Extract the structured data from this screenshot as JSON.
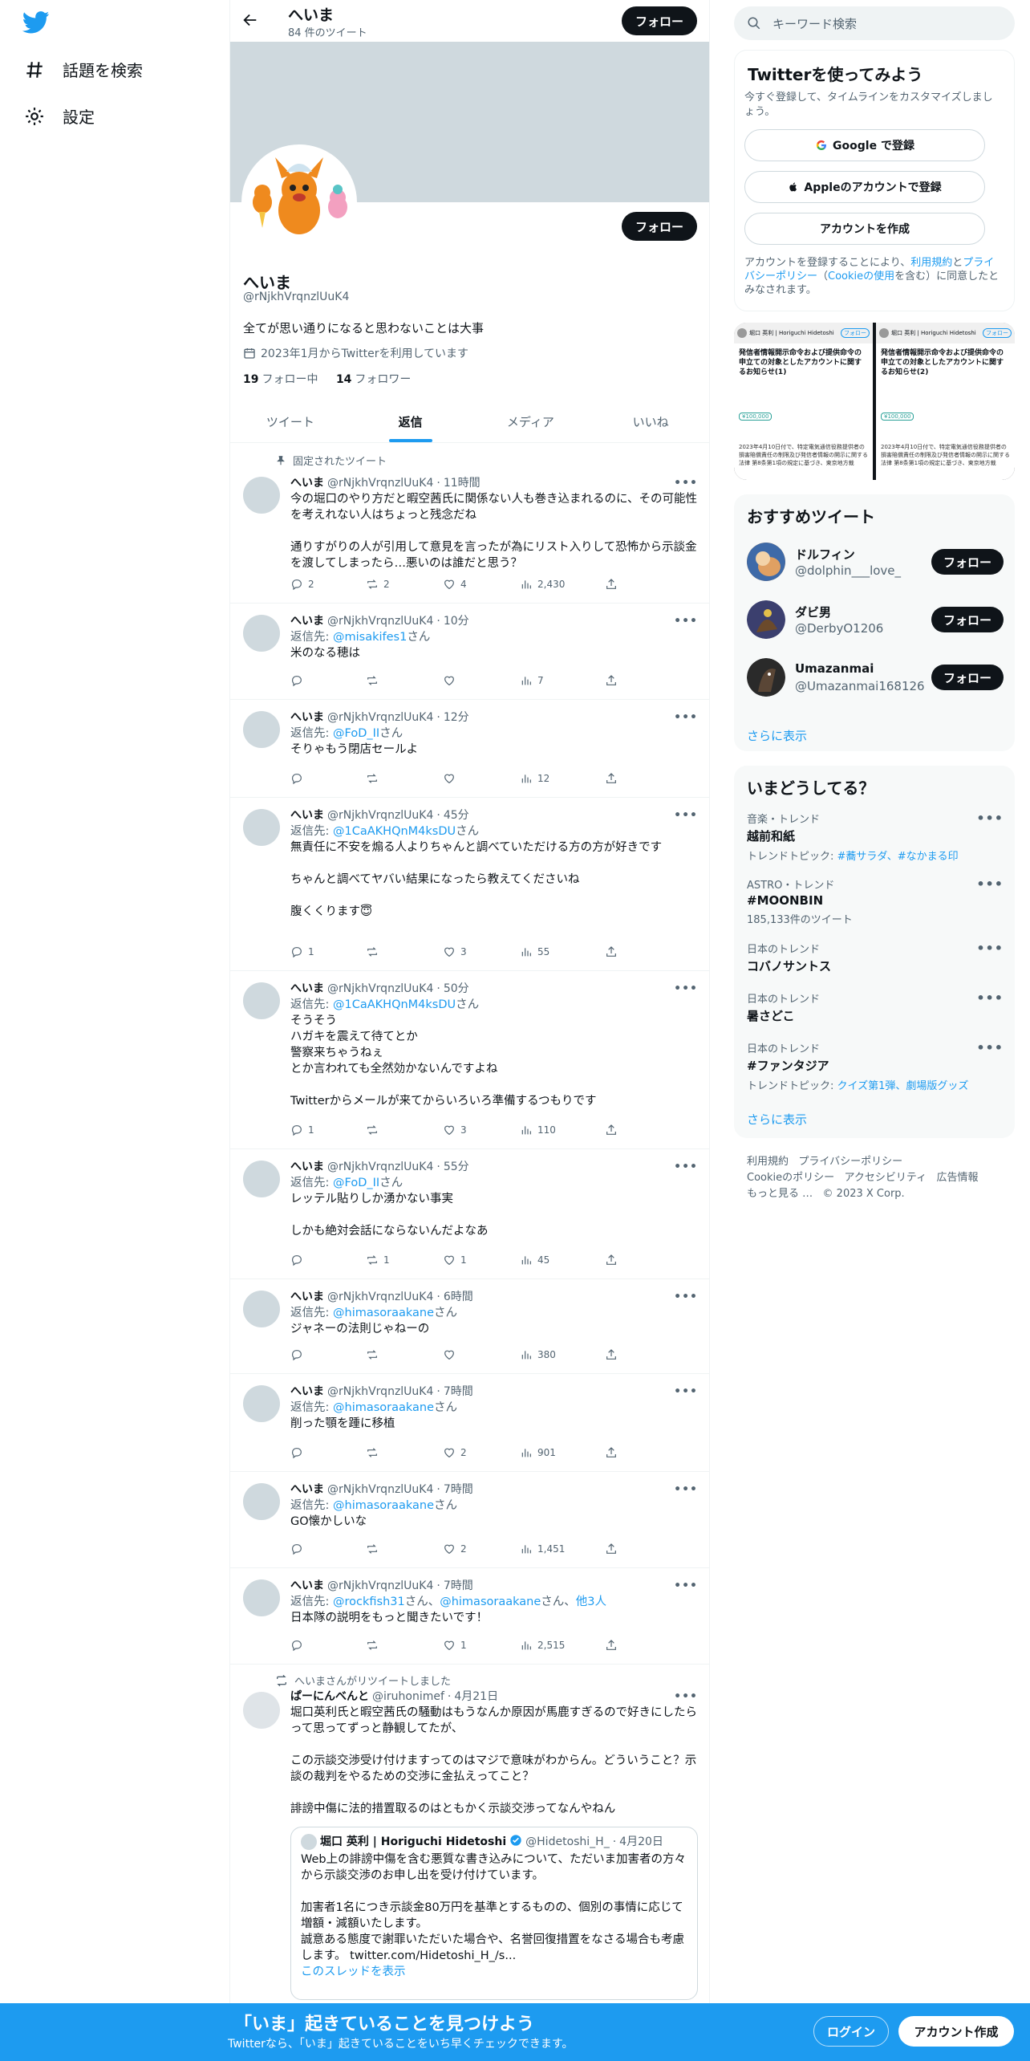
{
  "nav": {
    "explore": "話題を検索",
    "settings": "設定"
  },
  "header": {
    "name": "へいま",
    "tweet_count": "84 件のツイート",
    "follow": "フォロー"
  },
  "profile": {
    "name": "へいま",
    "handle": "@rNjkhVrqnzlUuK4",
    "bio": "全てが思い通りになると思わないことは大事",
    "joined": "2023年1月からTwitterを利用しています",
    "following_count": "19",
    "following_label": "フォロー中",
    "followers_count": "14",
    "followers_label": "フォロワー",
    "follow": "フォロー"
  },
  "tabs": [
    "ツイート",
    "返信",
    "メディア",
    "いいね"
  ],
  "tweets": [
    {
      "pinned": "固定されたツイート",
      "name": "へいま",
      "handle": "@rNjkhVrqnzlUuK4",
      "time": "11時間",
      "reply_to": "",
      "reply_suffix": "",
      "text": "今の堀口のやり方だと暇空茜氏に関係ない人も巻き込まれるのに、その可能性を考えれない人はちょっと残念だね\n\n通りすがりの人が引用して意見を言ったが為にリスト入りして恐怖から示談金を渡してしまったら…悪いのは誰だと思う？",
      "replies": "2",
      "retweets": "2",
      "likes": "4",
      "views": "2,430"
    },
    {
      "name": "へいま",
      "handle": "@rNjkhVrqnzlUuK4",
      "time": "10分",
      "reply_label": "返信先: ",
      "reply_to": "@misakifes1",
      "reply_suffix": "さん",
      "text": "米のなる穂は",
      "replies": "",
      "retweets": "",
      "likes": "",
      "views": "7"
    },
    {
      "name": "へいま",
      "handle": "@rNjkhVrqnzlUuK4",
      "time": "12分",
      "reply_label": "返信先: ",
      "reply_to": "@FoD_II",
      "reply_suffix": "さん",
      "text": "そりゃもう閉店セールよ",
      "replies": "",
      "retweets": "",
      "likes": "",
      "views": "12"
    },
    {
      "name": "へいま",
      "handle": "@rNjkhVrqnzlUuK4",
      "time": "45分",
      "reply_label": "返信先: ",
      "reply_to": "@1CaAKHQnM4ksDU",
      "reply_suffix": "さん",
      "text": "無責任に不安を煽る人よりちゃんと調べていただける方の方が好きです\n\nちゃんと調べてヤバい結果になったら教えてくださいね\n\n腹くくります😇",
      "replies": "1",
      "retweets": "",
      "likes": "3",
      "views": "55"
    },
    {
      "name": "へいま",
      "handle": "@rNjkhVrqnzlUuK4",
      "time": "50分",
      "reply_label": "返信先: ",
      "reply_to": "@1CaAKHQnM4ksDU",
      "reply_suffix": "さん",
      "text": "そうそう\nハガキを震えて待てとか\n警察来ちゃうねぇ\nとか言われても全然効かないんですよね\n\nTwitterからメールが来てからいろいろ準備するつもりです",
      "replies": "1",
      "retweets": "",
      "likes": "3",
      "views": "110"
    },
    {
      "name": "へいま",
      "handle": "@rNjkhVrqnzlUuK4",
      "time": "55分",
      "reply_label": "返信先: ",
      "reply_to": "@FoD_II",
      "reply_suffix": "さん",
      "text": "レッテル貼りしか湧かない事実\n\nしかも絶対会話にならないんだよなあ",
      "replies": "",
      "retweets": "1",
      "likes": "1",
      "views": "45"
    },
    {
      "name": "へいま",
      "handle": "@rNjkhVrqnzlUuK4",
      "time": "6時間",
      "reply_label": "返信先: ",
      "reply_to": "@himasoraakane",
      "reply_suffix": "さん",
      "text": "ジャネーの法則じゃねーの",
      "replies": "",
      "retweets": "",
      "likes": "",
      "views": "380"
    },
    {
      "name": "へいま",
      "handle": "@rNjkhVrqnzlUuK4",
      "time": "7時間",
      "reply_label": "返信先: ",
      "reply_to": "@himasoraakane",
      "reply_suffix": "さん",
      "text": "削った顎を踵に移植",
      "replies": "",
      "retweets": "",
      "likes": "2",
      "views": "901"
    },
    {
      "name": "へいま",
      "handle": "@rNjkhVrqnzlUuK4",
      "time": "7時間",
      "reply_label": "返信先: ",
      "reply_to": "@himasoraakane",
      "reply_suffix": "さん",
      "text": "GO懐かしいな",
      "replies": "",
      "retweets": "",
      "likes": "2",
      "views": "1,451"
    },
    {
      "name": "へいま",
      "handle": "@rNjkhVrqnzlUuK4",
      "time": "7時間",
      "reply_label": "返信先: ",
      "reply_to": "@rockfish31",
      "reply_suffix": "さん、",
      "reply_to2": "@himasoraakane",
      "reply_suffix2": "さん、",
      "reply_to3": "他3人",
      "text": "日本隊の説明をもっと聞きたいです！",
      "replies": "",
      "retweets": "",
      "likes": "1",
      "views": "2,515"
    }
  ],
  "retweet": {
    "context": "へいまさんがリツイートしました",
    "name": "ぱーにんべんと",
    "handle": "@iruhonimef",
    "time": "4月21日",
    "text": "堀口英利氏と暇空茜氏の騒動はもうなんか原因が馬鹿すぎるので好きにしたらって思ってずっと静観してたが、\n\nこの示談交渉受け付けますってのはマジで意味がわからん。どういうこと？示談の裁判をやるための交渉に金払えってこと？\n\n誹謗中傷に法的措置取るのはともかく示談交渉ってなんやねん",
    "quote": {
      "name": "堀口 英利 | Horiguchi Hidetoshi",
      "handle": "@Hidetoshi_H_",
      "time": "4月20日",
      "text": "Web上の誹謗中傷を含む悪質な書き込みについて、ただいま加害者の方々から示談交渉のお申し出を受け付けています。\n\n加害者1名につき示談金80万円を基準とするものの、個別の事情に応じて増額・減額いたします。\n誠意ある態度で謝罪いただいた場合や、名誉回復措置をなさる場合も考慮します。 twitter.com/Hidetoshi_H_/s...",
      "thread": "このスレッドを表示"
    }
  },
  "right": {
    "search_placeholder": "キーワード検索",
    "signup": {
      "title": "Twitterを使ってみよう",
      "subtitle": "今すぐ登録して、タイムラインをカスタマイズしましょう。",
      "google": "Google で登録",
      "apple": "Appleのアカウントで登録",
      "create": "アカウントを作成",
      "legal_1": "アカウントを登録することにより、",
      "legal_terms": "利用規約",
      "legal_2": "と",
      "legal_privacy": "プライバシーポリシー",
      "legal_3": "（",
      "legal_cookie": "Cookieの使用",
      "legal_4": "を含む）に同意したとみなされます。"
    },
    "media": {
      "left_title": "発信者情報開示命令および提供命令の申立ての対象としたアカウントに関するお知らせ(1)",
      "right_title": "発信者情報開示命令および提供命令の申立ての対象としたアカウントに関するお知らせ(2)",
      "left_amount": "¥100,000",
      "right_amount": "¥100,000",
      "left_author": "堀口 英利 | Horiguchi Hidetoshi",
      "right_author": "堀口 英利 | Horiguchi Hidetoshi",
      "left_follow": "フォロー",
      "right_follow": "フォロー",
      "left_excerpt": "2023年4月10日付で、特定電気通信役務提供者の損害賠償責任の制限及び発信者情報の開示に関する法律 第8条第1項の規定に基づき、東京地方裁",
      "right_excerpt": "2023年4月10日付で、特定電気通信役務提供者の損害賠償責任の制限及び発信者情報の開示に関する法律 第8条第1項の規定に基づき、東京地方裁"
    },
    "recommend": {
      "title": "おすすめツイート",
      "users": [
        {
          "name": "ドルフィン",
          "handle": "@dolphin___love_",
          "follow": "フォロー"
        },
        {
          "name": "ダビ男",
          "handle": "@DerbyO1206",
          "follow": "フォロー"
        },
        {
          "name": "Umazanmai",
          "handle": "@Umazanmai168126",
          "follow": "フォロー"
        }
      ],
      "more": "さらに表示"
    },
    "trends": {
      "title": "いまどうしてる？",
      "items": [
        {
          "cat": "音楽・トレンド",
          "title": "越前和紙",
          "sub_label": "トレンドトピック: ",
          "sub_link": "#蕎サラダ、#なかまる印"
        },
        {
          "cat": "ASTRO・トレンド",
          "title": "#MOONBIN",
          "sub_label": "185,133件のツイート",
          "sub_link": ""
        },
        {
          "cat": "日本のトレンド",
          "title": "コバノサントス",
          "sub_label": "",
          "sub_link": ""
        },
        {
          "cat": "日本のトレンド",
          "title": "暑さどこ",
          "sub_label": "",
          "sub_link": ""
        },
        {
          "cat": "日本のトレンド",
          "title": "#ファンタジア",
          "sub_label": "トレンドトピック: ",
          "sub_link": "クイズ第1弾、劇場版グッズ"
        }
      ],
      "more": "さらに表示"
    },
    "footer": {
      "terms": "利用規約",
      "privacy": "プライバシーポリシー",
      "cookie": "Cookieのポリシー",
      "accessibility": "アクセシビリティ",
      "ads": "広告情報",
      "more": "もっと見る …",
      "copyright": "© 2023 X Corp."
    }
  },
  "bottom": {
    "headline": "「いま」起きていることを見つけよう",
    "sub": "Twitterなら、「いま」起きていることをいち早くチェックできます。",
    "login": "ログイン",
    "signup": "アカウント作成"
  }
}
